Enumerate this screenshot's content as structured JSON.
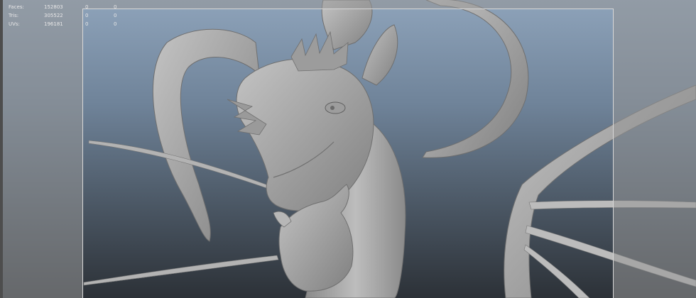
{
  "hud": {
    "rows": [
      {
        "label": "Faces:",
        "v1": "152803",
        "v2": "0",
        "v3": "0"
      },
      {
        "label": "Tris:",
        "v1": "305522",
        "v2": "0",
        "v3": "0"
      },
      {
        "label": "UVs:",
        "v1": "196181",
        "v2": "0",
        "v3": "0"
      }
    ]
  },
  "colors": {
    "mesh": "#a9a9a9",
    "mesh_shadow": "#6d6d6d",
    "background_top": "#8ea3ba",
    "background_bottom": "#2c3137"
  }
}
